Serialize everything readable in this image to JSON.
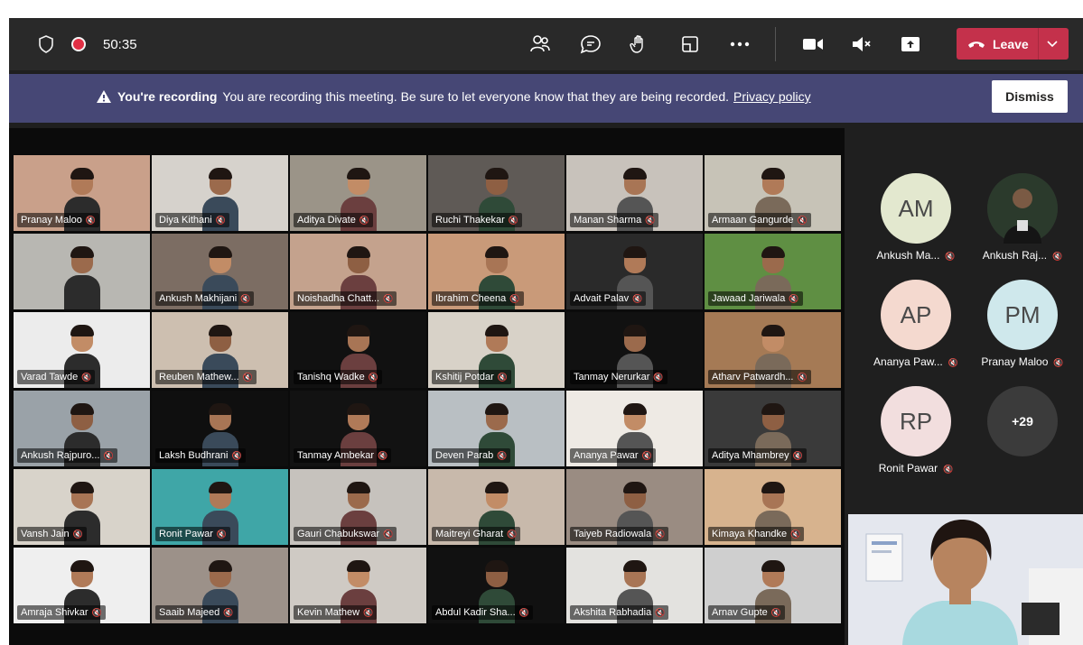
{
  "call": {
    "timer": "50:35",
    "leave_label": "Leave",
    "icons": {
      "shield": "shield-icon",
      "recording": "recording-dot-icon",
      "participants": "participants-icon",
      "chat": "chat-icon",
      "raise_hand": "raise-hand-icon",
      "rooms": "breakout-rooms-icon",
      "more": "more-options-icon",
      "camera": "camera-icon",
      "mic": "mic-muted-icon",
      "share": "share-screen-icon",
      "leave": "phone-hangup-icon",
      "leave_caret": "chevron-down-icon"
    }
  },
  "banner": {
    "title": "You're recording",
    "message": "You are recording this meeting. Be sure to let everyone know that they are being recorded.",
    "link": "Privacy policy",
    "dismiss": "Dismiss",
    "icon": "warning-icon"
  },
  "grid": {
    "tiles": [
      {
        "name": "Pranay Maloo",
        "bg": "#c9a08a"
      },
      {
        "name": "Diya Kithani",
        "bg": "#d6d2cc"
      },
      {
        "name": "Aditya Divate",
        "bg": "#9b9488"
      },
      {
        "name": "Ruchi Thakekar",
        "bg": "#5f5a56"
      },
      {
        "name": "Manan Sharma",
        "bg": "#c8c2bb"
      },
      {
        "name": "Armaan Gangurde",
        "bg": "#c7c3b7"
      },
      {
        "name": "",
        "bg": "#b8b7b2"
      },
      {
        "name": "Ankush Makhijani",
        "bg": "#7c6d63"
      },
      {
        "name": "Noishadha Chatt...",
        "bg": "#c4a28d"
      },
      {
        "name": "Ibrahim Cheena",
        "bg": "#c99a79"
      },
      {
        "name": "Advait Palav",
        "bg": "#2a2a2a"
      },
      {
        "name": "Jawaad Jariwala",
        "bg": "#5f8f43"
      },
      {
        "name": "Varad Tawde",
        "bg": "#ececec"
      },
      {
        "name": "Reuben Mathew...",
        "bg": "#cdbfb0"
      },
      {
        "name": "Tanishq Wadke",
        "bg": "#111111"
      },
      {
        "name": "Kshitij Potdar",
        "bg": "#d8d2c8"
      },
      {
        "name": "Tanmay Nerurkar",
        "bg": "#111111"
      },
      {
        "name": "Atharv Patwardh...",
        "bg": "#a57a55"
      },
      {
        "name": "Ankush Rajpuro...",
        "bg": "#9aa2a8"
      },
      {
        "name": "Laksh Budhrani",
        "bg": "#0f0f0f"
      },
      {
        "name": "Tanmay Ambekar",
        "bg": "#121212"
      },
      {
        "name": "Deven Parab",
        "bg": "#b9bfc3"
      },
      {
        "name": "Ananya Pawar",
        "bg": "#eeeae4"
      },
      {
        "name": "Aditya Mhambrey",
        "bg": "#3a3a3a"
      },
      {
        "name": "Vansh Jain",
        "bg": "#d8d3ca"
      },
      {
        "name": "Ronit Pawar",
        "bg": "#3fa6a7"
      },
      {
        "name": "Gauri Chabukswar",
        "bg": "#c6c2bd"
      },
      {
        "name": "Maitreyi Gharat",
        "bg": "#c8b9ab"
      },
      {
        "name": "Taiyeb Radiowala",
        "bg": "#9a8c82"
      },
      {
        "name": "Kimaya Khandke",
        "bg": "#d7b38e"
      },
      {
        "name": "Amraja Shivkar",
        "bg": "#efefef"
      },
      {
        "name": "Saaib Majeed",
        "bg": "#9c9189"
      },
      {
        "name": "Kevin Mathew",
        "bg": "#cfcac4"
      },
      {
        "name": "Abdul Kadir Sha...",
        "bg": "#111111"
      },
      {
        "name": "Akshita Rabhadia",
        "bg": "#e3e2df"
      },
      {
        "name": "Arnav Gupte",
        "bg": "#cfcfcf"
      }
    ]
  },
  "roster": {
    "mic_icon": "mic-muted-icon",
    "items": [
      {
        "initials": "AM",
        "name": "Ankush Ma...",
        "color": "#e3e8cf"
      },
      {
        "initials": "",
        "name": "Ankush Raj...",
        "color": "#2b2b2b",
        "photo": true
      },
      {
        "initials": "AP",
        "name": "Ananya Paw...",
        "color": "#f4d9cf"
      },
      {
        "initials": "PM",
        "name": "Pranay Maloo",
        "color": "#cfe8ec"
      },
      {
        "initials": "RP",
        "name": "Ronit Pawar",
        "color": "#f2dede"
      },
      {
        "initials": "+29",
        "name": "",
        "color": "#3b3b3b"
      }
    ]
  }
}
